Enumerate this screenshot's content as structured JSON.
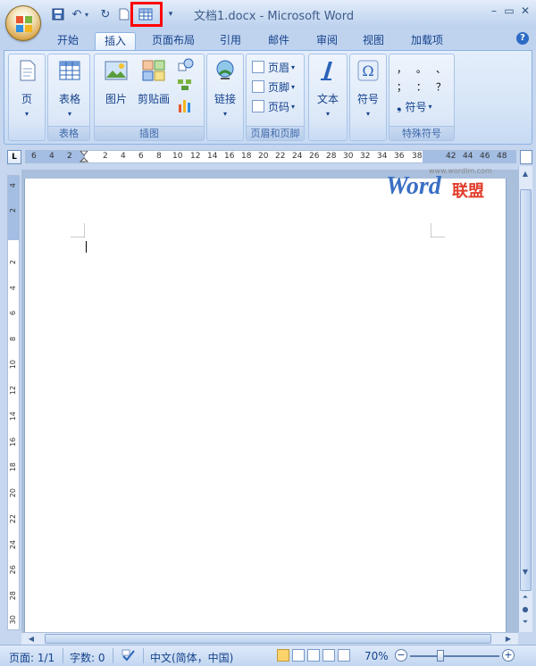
{
  "window": {
    "title": "文档1.docx - Microsoft Word"
  },
  "tabs": [
    "开始",
    "插入",
    "页面布局",
    "引用",
    "邮件",
    "审阅",
    "视图",
    "加载项"
  ],
  "active_tab": "插入",
  "ribbon": {
    "groups": {
      "page": {
        "label": "",
        "button": "页"
      },
      "table": {
        "label": "表格",
        "button": "表格"
      },
      "illustrations": {
        "label": "插图",
        "picture": "图片",
        "clipart": "剪贴画"
      },
      "links": {
        "label": "",
        "button": "链接"
      },
      "header_footer": {
        "label": "页眉和页脚",
        "header": "页眉",
        "footer": "页脚",
        "page_number": "页码"
      },
      "text": {
        "label": "",
        "button": "文本"
      },
      "symbols": {
        "label": "",
        "button": "符号"
      },
      "special": {
        "label": "特殊符号",
        "button": "符号",
        "chars": [
          "，",
          "。",
          "、",
          "；",
          "：",
          "？"
        ]
      }
    }
  },
  "ruler": {
    "h_ticks": [
      "6",
      "4",
      "2",
      "2",
      "4",
      "6",
      "8",
      "10",
      "12",
      "14",
      "16",
      "18",
      "20",
      "22",
      "24",
      "26",
      "28",
      "30",
      "32",
      "34",
      "36",
      "38",
      "42",
      "44",
      "46",
      "48"
    ],
    "v_ticks": [
      "4",
      "2",
      "2",
      "4",
      "6",
      "8",
      "10",
      "12",
      "14",
      "16",
      "18",
      "20",
      "22",
      "24",
      "26",
      "28",
      "30"
    ]
  },
  "watermark": {
    "url": "www.wordlm.com",
    "word": "Word",
    "brand": "联盟"
  },
  "status": {
    "page": "页面: 1/1",
    "words": "字数: 0",
    "language": "中文(简体，中国)",
    "zoom": "70%"
  }
}
